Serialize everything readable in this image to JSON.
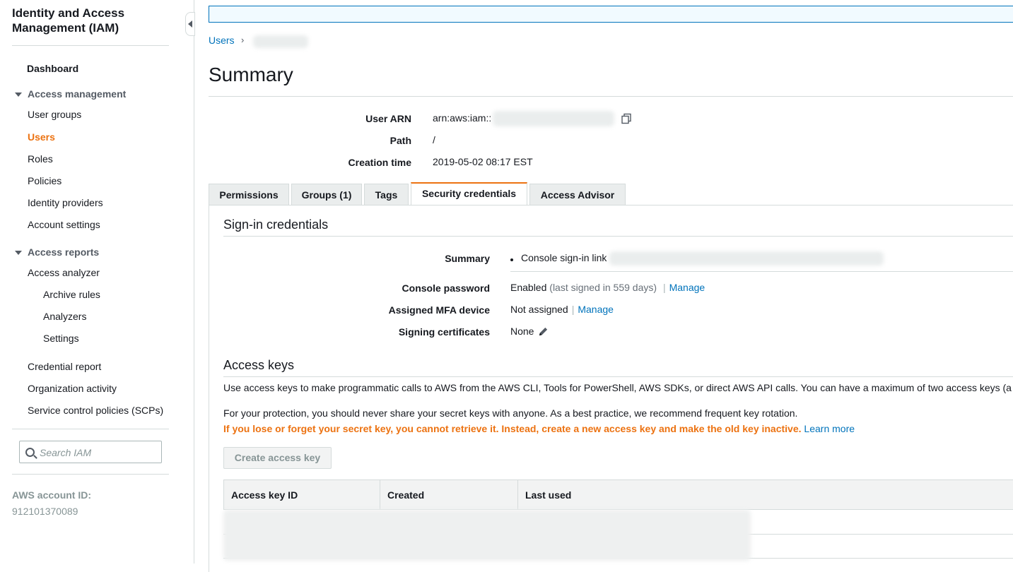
{
  "sidebar": {
    "title": "Identity and Access Management (IAM)",
    "dashboard": "Dashboard",
    "access_management": {
      "label": "Access management",
      "items": [
        "User groups",
        "Users",
        "Roles",
        "Policies",
        "Identity providers",
        "Account settings"
      ],
      "active": "Users"
    },
    "access_reports": {
      "label": "Access reports",
      "analyzer": "Access analyzer",
      "analyzer_items": [
        "Archive rules",
        "Analyzers",
        "Settings"
      ],
      "other_items": [
        "Credential report",
        "Organization activity",
        "Service control policies (SCPs)"
      ]
    },
    "search": {
      "placeholder": "Search IAM"
    },
    "account": {
      "label": "AWS account ID:",
      "value": "912101370089"
    }
  },
  "breadcrumb": {
    "root": "Users",
    "separator": "›"
  },
  "page": {
    "title": "Summary"
  },
  "summary": {
    "user_arn_label": "User ARN",
    "user_arn_value": "arn:aws:iam::",
    "path_label": "Path",
    "path_value": "/",
    "creation_time_label": "Creation time",
    "creation_time_value": "2019-05-02 08:17 EST"
  },
  "tabs": [
    {
      "label": "Permissions",
      "active": false
    },
    {
      "label": "Groups (1)",
      "active": false
    },
    {
      "label": "Tags",
      "active": false
    },
    {
      "label": "Security credentials",
      "active": true
    },
    {
      "label": "Access Advisor",
      "active": false
    }
  ],
  "signin": {
    "heading": "Sign-in credentials",
    "summary_label": "Summary",
    "summary_value": "Console sign-in link",
    "console_password_label": "Console password",
    "console_password_value": "Enabled",
    "console_password_note": "(last signed in 559 days)",
    "pipe": "|",
    "manage": "Manage",
    "mfa_label": "Assigned MFA device",
    "mfa_value": "Not assigned",
    "signing_label": "Signing certificates",
    "signing_value": "None"
  },
  "access_keys": {
    "heading": "Access keys",
    "description": "Use access keys to make programmatic calls to AWS from the AWS CLI, Tools for PowerShell, AWS SDKs, or direct AWS API calls. You can have a maximum of two access keys (a",
    "protection": "For your protection, you should never share your secret keys with anyone. As a best practice, we recommend frequent key rotation.",
    "warning": "If you lose or forget your secret key, you cannot retrieve it. Instead, create a new access key and make the old key inactive.",
    "learn_more": "Learn more",
    "create_button": "Create access key",
    "columns": [
      "Access key ID",
      "Created",
      "Last used"
    ]
  },
  "colors": {
    "accent": "#ec7211",
    "link": "#0073bb",
    "border": "#d5dbdb"
  }
}
